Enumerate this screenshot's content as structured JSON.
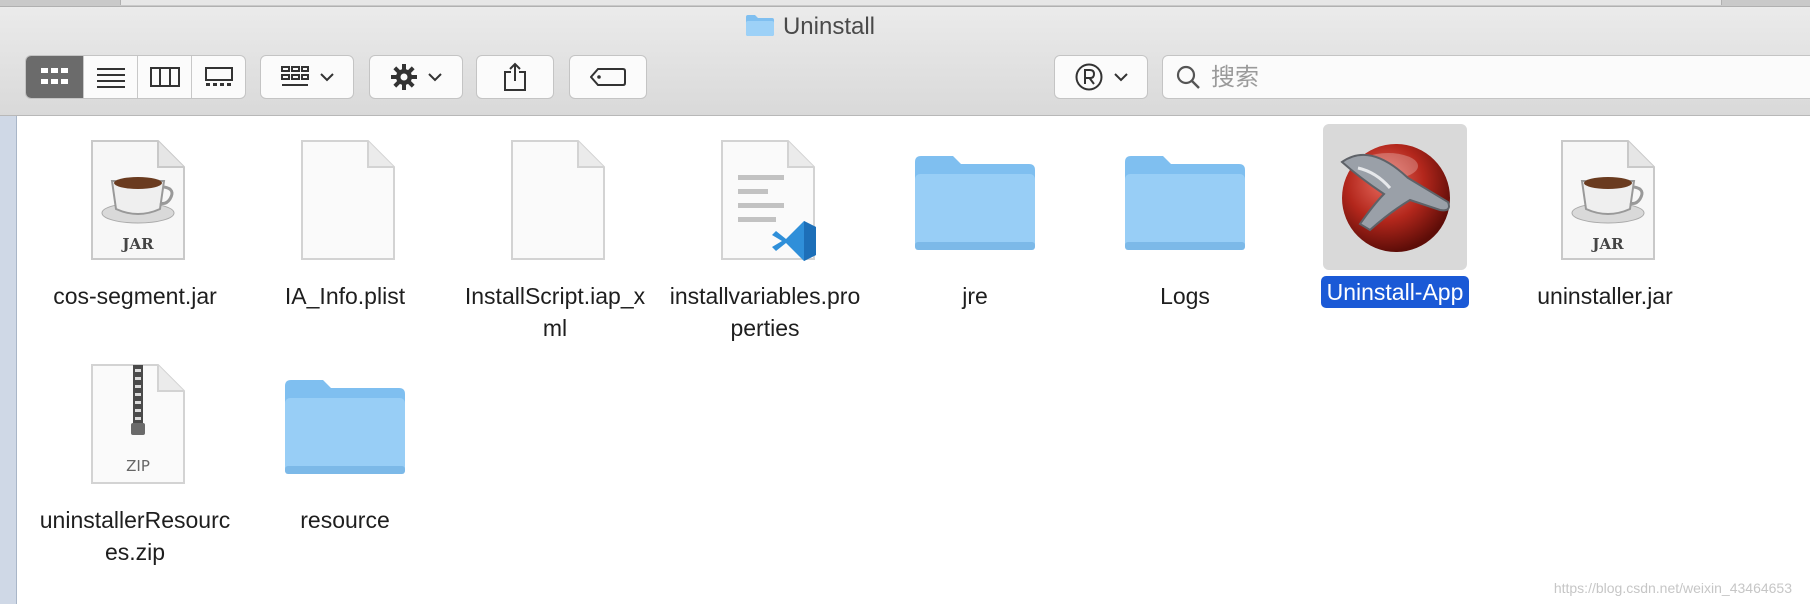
{
  "window": {
    "title": "Uninstall"
  },
  "search": {
    "placeholder": "搜索"
  },
  "colors": {
    "selection": "#1a59d6",
    "folder": "#8cc8f5"
  },
  "toolbar": {
    "view_modes": [
      "icon-view",
      "list-view",
      "column-view",
      "gallery-view"
    ],
    "active_view": "icon-view"
  },
  "files": [
    {
      "name": "cos-segment.jar",
      "kind": "jar",
      "badge": "JAR"
    },
    {
      "name": "IA_Info.plist",
      "kind": "blank"
    },
    {
      "name": "InstallScript.iap_xml",
      "kind": "blank"
    },
    {
      "name": "installvariables.properties",
      "kind": "vscode-doc"
    },
    {
      "name": "jre",
      "kind": "folder"
    },
    {
      "name": "Logs",
      "kind": "folder"
    },
    {
      "name": "Uninstall-App",
      "kind": "app",
      "selected": true
    },
    {
      "name": "uninstaller.jar",
      "kind": "jar",
      "badge": "JAR"
    },
    {
      "name": "uninstallerResources.zip",
      "kind": "zip",
      "badge": "ZIP"
    },
    {
      "name": "resource",
      "kind": "folder"
    }
  ],
  "watermark": "https://blog.csdn.net/weixin_43464653"
}
